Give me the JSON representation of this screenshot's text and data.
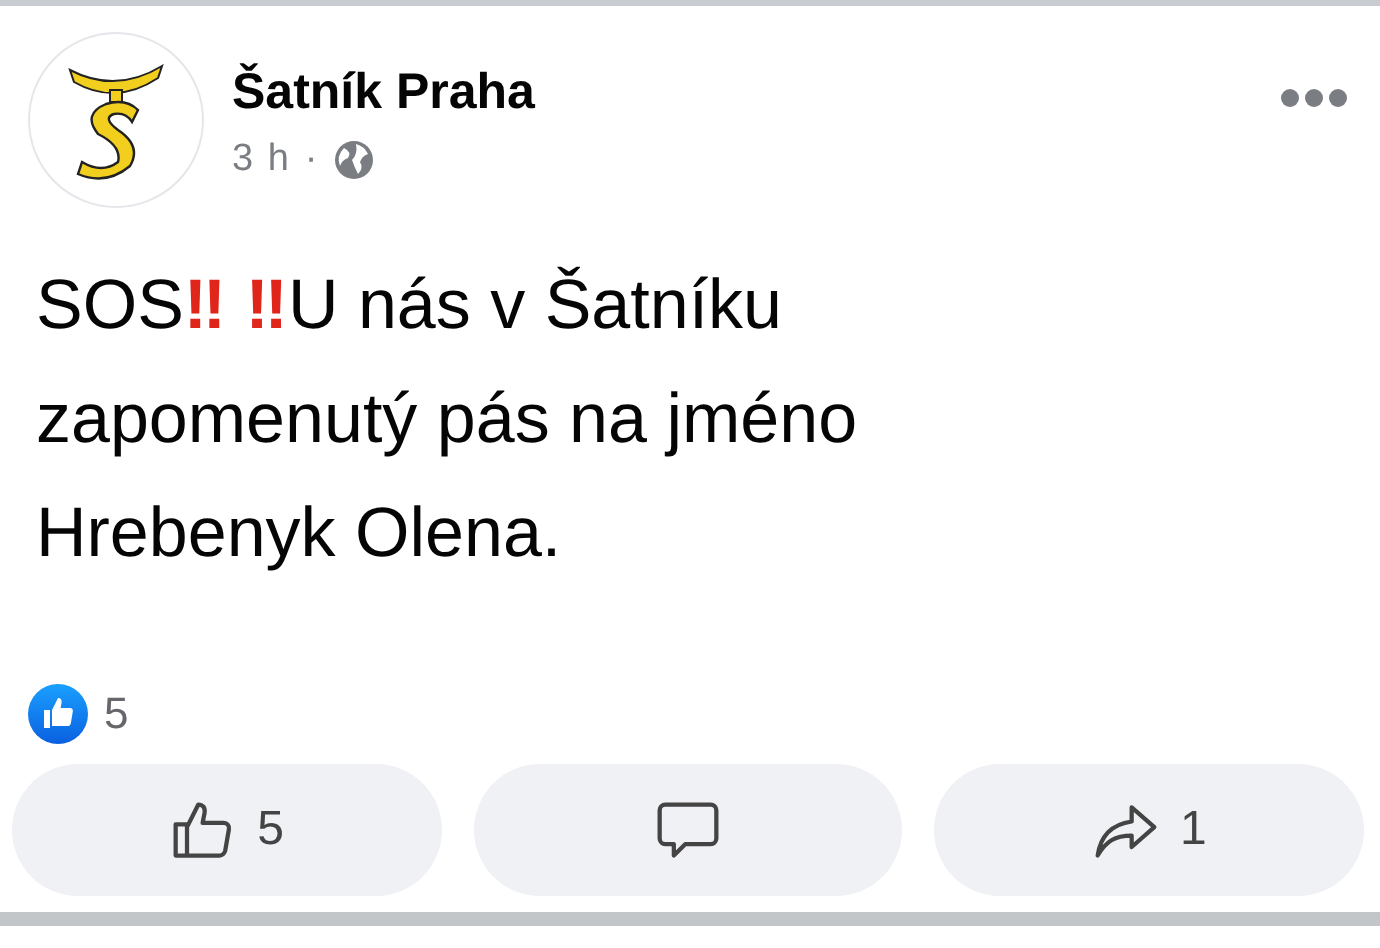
{
  "post": {
    "author": "Šatník Praha",
    "time": "3 h",
    "separator": "·",
    "text": [
      {
        "kind": "text",
        "text": "SOS"
      },
      {
        "kind": "emoji",
        "text": "‼"
      },
      {
        "kind": "emoji",
        "text": " ‼"
      },
      {
        "kind": "text",
        "text": "U nás v Šatníku zapomenutý pás na jméno Hrebenyk Olena."
      }
    ],
    "reactions": {
      "count": "5"
    },
    "actions": [
      {
        "kind": "like",
        "count": "5"
      },
      {
        "kind": "comment"
      },
      {
        "kind": "share",
        "count": "1"
      }
    ]
  }
}
